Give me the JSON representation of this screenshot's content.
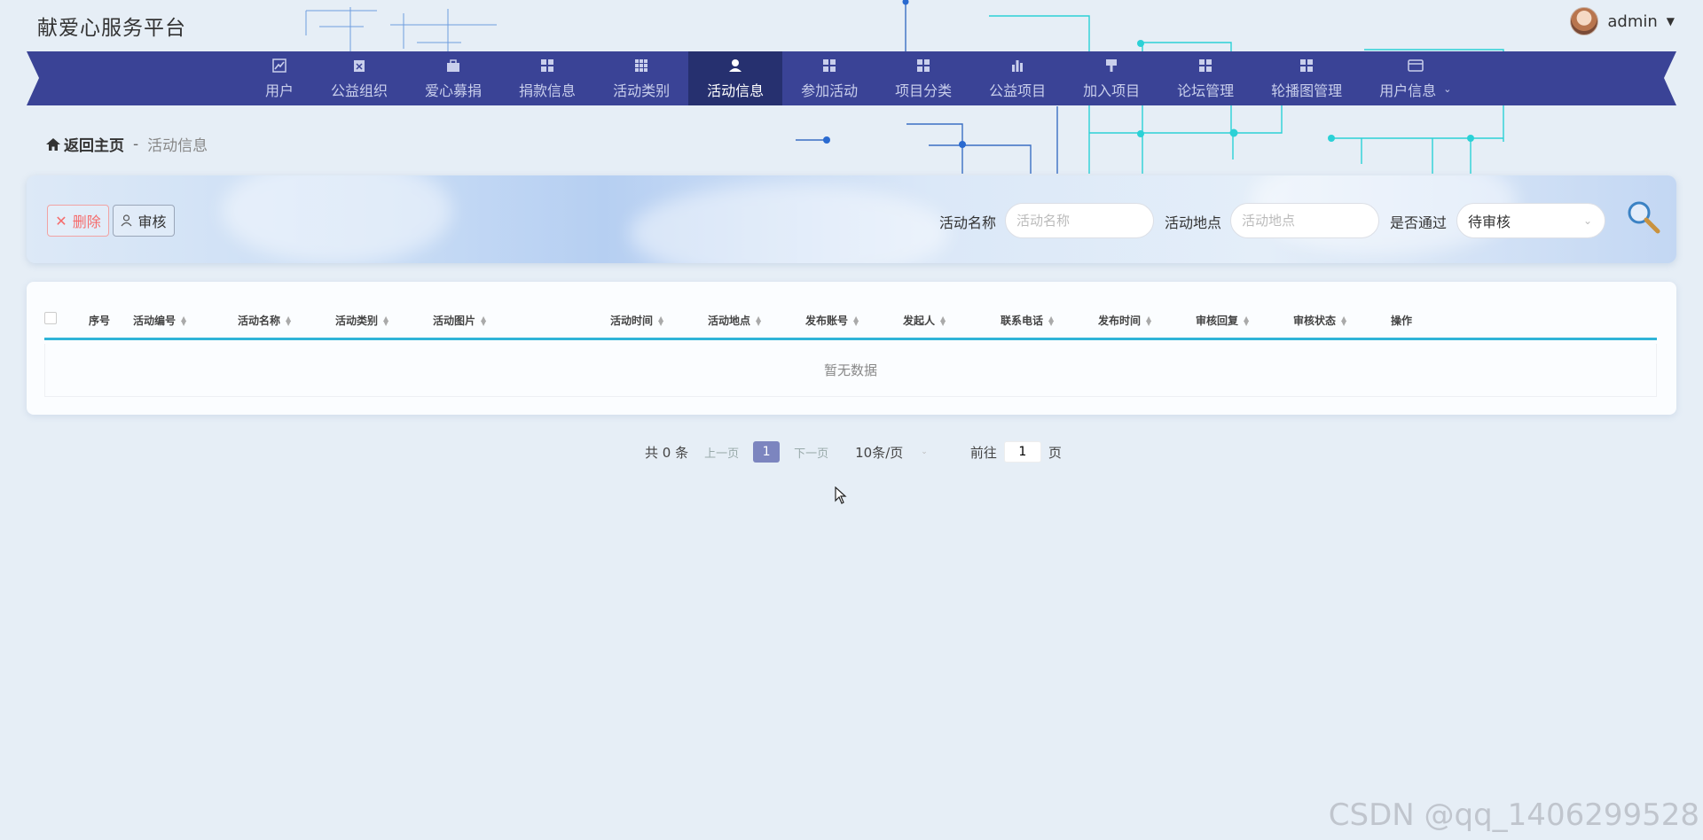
{
  "header": {
    "site_title": "献爱心服务平台",
    "user": "admin"
  },
  "nav": [
    {
      "label": "用户",
      "icon": "chart-icon"
    },
    {
      "label": "公益组织",
      "icon": "clipboard-icon"
    },
    {
      "label": "爱心募捐",
      "icon": "briefcase-icon"
    },
    {
      "label": "捐款信息",
      "icon": "grid-icon"
    },
    {
      "label": "活动类别",
      "icon": "dots-grid-icon"
    },
    {
      "label": "活动信息",
      "icon": "person-icon",
      "active": true
    },
    {
      "label": "参加活动",
      "icon": "grid-icon"
    },
    {
      "label": "项目分类",
      "icon": "grid-icon"
    },
    {
      "label": "公益项目",
      "icon": "bar-chart-icon"
    },
    {
      "label": "加入项目",
      "icon": "brush-icon"
    },
    {
      "label": "论坛管理",
      "icon": "grid-icon"
    },
    {
      "label": "轮播图管理",
      "icon": "grid-icon"
    },
    {
      "label": "用户信息",
      "icon": "card-icon",
      "dropdown": true
    }
  ],
  "breadcrumb": {
    "home": "返回主页",
    "sep": "-",
    "current": "活动信息"
  },
  "toolbar": {
    "delete_label": "删除",
    "audit_label": "审核"
  },
  "filters": {
    "name_label": "活动名称",
    "name_placeholder": "活动名称",
    "name_value": "",
    "place_label": "活动地点",
    "place_placeholder": "活动地点",
    "place_value": "",
    "pass_label": "是否通过",
    "pass_value": "待审核"
  },
  "table": {
    "columns": [
      "序号",
      "活动编号",
      "活动名称",
      "活动类别",
      "活动图片",
      "活动时间",
      "活动地点",
      "发布账号",
      "发起人",
      "联系电话",
      "发布时间",
      "审核回复",
      "审核状态",
      "操作"
    ],
    "empty_text": "暂无数据"
  },
  "pagination": {
    "total": "共 0 条",
    "prev": "上一页",
    "current_page": "1",
    "next": "下一页",
    "page_size": "10条/页",
    "goto_label": "前往",
    "goto_value": "1",
    "page_suffix": "页"
  },
  "watermark": "CSDN @qq_1406299528",
  "colors": {
    "nav_bg": "#3a4396",
    "nav_active": "#26306f",
    "accent": "#2fb4d8",
    "delete": "#f56c6c"
  }
}
